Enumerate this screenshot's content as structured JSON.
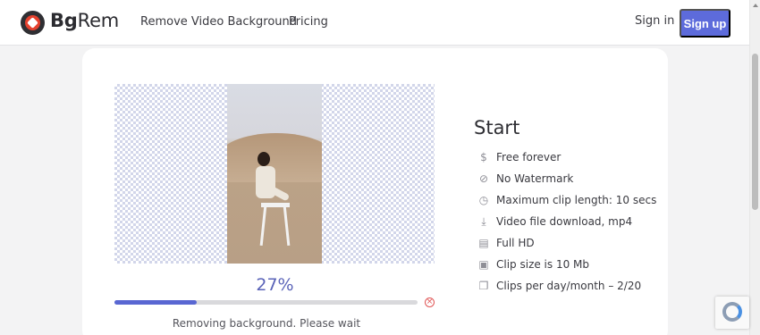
{
  "header": {
    "brand_bold": "Bg",
    "brand_light": "Rem",
    "nav": [
      "Remove Video Background",
      "Pricing"
    ],
    "signin": "Sign in",
    "signup": "Sign up"
  },
  "colors": {
    "accent": "#5d6bdb",
    "progress": "#5967d2",
    "cancel": "#e05555"
  },
  "upload": {
    "percent": "27%",
    "progress_value": 0.27,
    "status": "Removing background. Please wait",
    "cancel_icon": "cancel-circle-icon"
  },
  "plan": {
    "title": "Start",
    "features": [
      {
        "icon": "dollar-icon",
        "glyph": "$",
        "label": "Free forever"
      },
      {
        "icon": "no-watermark-icon",
        "glyph": "⊘",
        "label": "No Watermark"
      },
      {
        "icon": "clock-icon",
        "glyph": "◷",
        "label": "Maximum clip length: 10 secs"
      },
      {
        "icon": "download-icon",
        "glyph": "⤓",
        "label": "Video file download, mp4"
      },
      {
        "icon": "hd-icon",
        "glyph": "▤",
        "label": "Full HD"
      },
      {
        "icon": "file-size-icon",
        "glyph": "▣",
        "label": "Clip size is 10 Mb"
      },
      {
        "icon": "clips-icon",
        "glyph": "❐",
        "label": "Clips per day/month – 2/20"
      }
    ]
  }
}
